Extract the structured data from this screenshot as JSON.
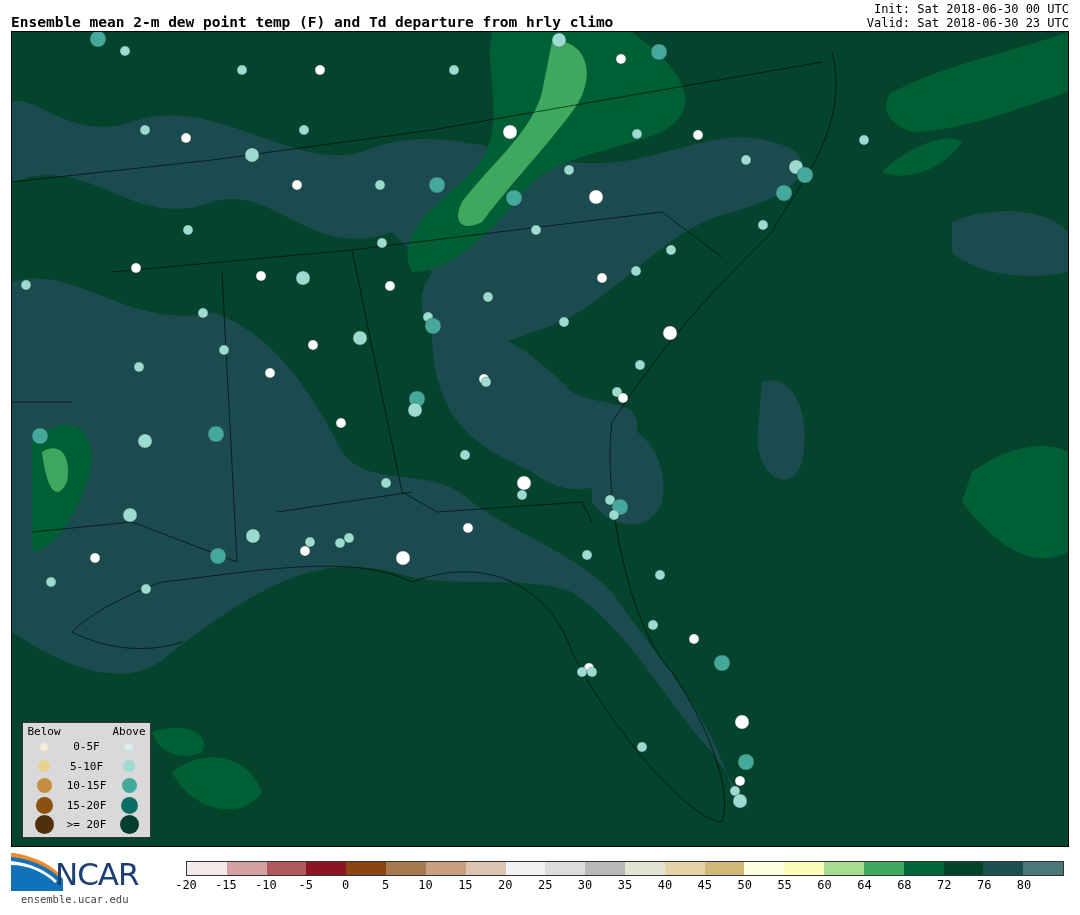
{
  "title": "Ensemble mean 2-m dew point temp (F) and Td departure from hrly climo",
  "init": "Init: Sat 2018-06-30 00 UTC",
  "valid": "Valid: Sat 2018-06-30 23 UTC",
  "legend": {
    "below_heading": "Below",
    "above_heading": "Above",
    "rows": [
      {
        "label": "0-5F",
        "below": {
          "color": "#f5ecd4"
        },
        "above": {
          "color": "#d4efec"
        }
      },
      {
        "label": "5-10F",
        "below": {
          "color": "#e8cf90"
        },
        "above": {
          "color": "#9cdcd0"
        }
      },
      {
        "label": "10-15F",
        "below": {
          "color": "#c68c40"
        },
        "above": {
          "color": "#44a89a"
        }
      },
      {
        "label": "15-20F",
        "below": {
          "color": "#8c500f"
        },
        "above": {
          "color": "#0b6e64"
        }
      },
      {
        "label": ">= 20F",
        "below": {
          "color": "#50300a"
        },
        "above": {
          "color": "#053d30"
        }
      }
    ]
  },
  "logo": {
    "name": "NCAR",
    "url": "ensemble.ucar.edu"
  },
  "colorbar": {
    "segments": [
      {
        "color": "#f5e8e8"
      },
      {
        "color": "#d4a0a4"
      },
      {
        "color": "#b05a5c"
      },
      {
        "color": "#8b1520"
      },
      {
        "color": "#8b4513"
      },
      {
        "color": "#a87850"
      },
      {
        "color": "#c8a080"
      },
      {
        "color": "#dcc4b0"
      },
      {
        "color": "#f2f2f2"
      },
      {
        "color": "#dcdcdc"
      },
      {
        "color": "#b8b8b8"
      },
      {
        "color": "#e4e4d4"
      },
      {
        "color": "#e4d4a8"
      },
      {
        "color": "#d0b878"
      },
      {
        "color": "#fffee0"
      },
      {
        "color": "#fbfbb8"
      },
      {
        "color": "#a8dc90"
      },
      {
        "color": "#40a860"
      },
      {
        "color": "#006838"
      },
      {
        "color": "#004428"
      },
      {
        "color": "#1a5050"
      },
      {
        "color": "#4a7878"
      }
    ],
    "ticks": [
      "-20",
      "-15",
      "-10",
      "-5",
      "0",
      "5",
      "10",
      "15",
      "20",
      "25",
      "30",
      "35",
      "40",
      "45",
      "50",
      "55",
      "60",
      "64",
      "68",
      "72",
      "76",
      "80"
    ]
  }
}
